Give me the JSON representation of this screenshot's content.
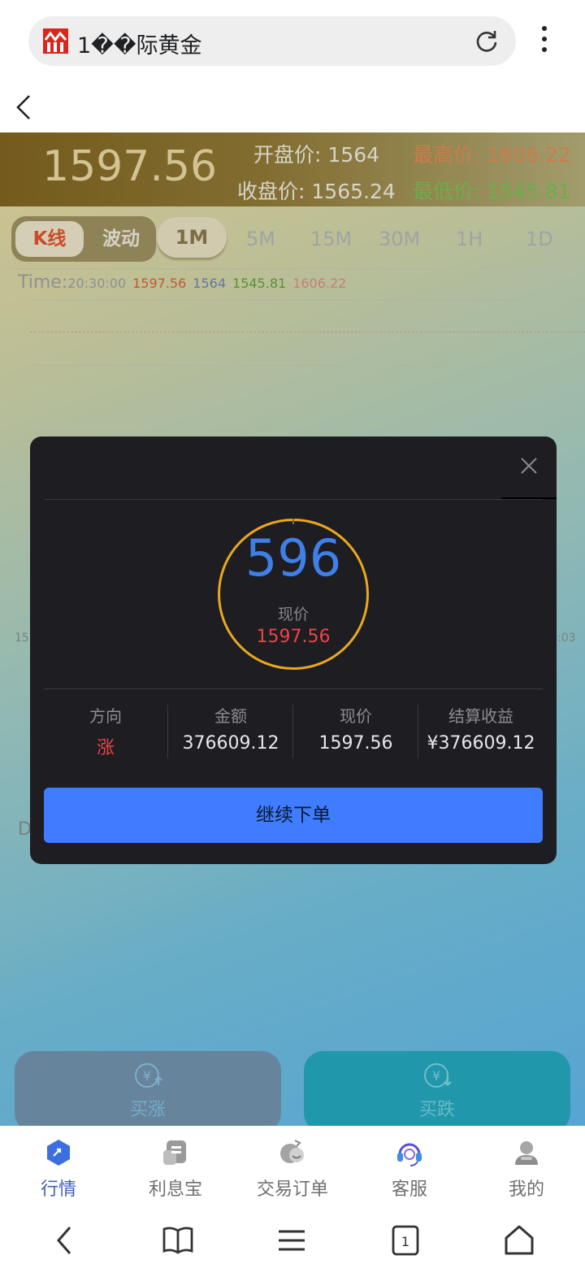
{
  "browser": {
    "url_text": "1��际黄金",
    "reload_icon": "reload-icon",
    "menu_icon": "more-vert-icon"
  },
  "header": {
    "back_icon": "chevron-left-icon"
  },
  "ticker": {
    "current_price": "1597.56",
    "open_label": "开盘价:",
    "open_value": "1564",
    "high_label": "最高价:",
    "high_value": "1606.22",
    "close_label": "收盘价:",
    "close_value": "1565.24",
    "low_label": "最低价:",
    "low_value": "1545.81"
  },
  "chart_mode": {
    "kline": "K线",
    "wave": "波动"
  },
  "timeframes": [
    "1M",
    "5M",
    "15M",
    "30M",
    "1H",
    "1D"
  ],
  "active_timeframe": "1M",
  "time_row": {
    "label": "Time:",
    "time": "20:30:00",
    "close": "1597.56",
    "open": "1564",
    "low": "1545.81",
    "high": "1606.22"
  },
  "axis": {
    "left_fragment": "15",
    "right_fragment": ":03",
    "d_fragment": "D"
  },
  "modal": {
    "countdown": "596",
    "price_label": "现价",
    "price_value": "1597.56",
    "stats": [
      {
        "label": "方向",
        "value": "涨"
      },
      {
        "label": "金额",
        "value": "376609.12"
      },
      {
        "label": "现价",
        "value": "1597.56"
      },
      {
        "label": "结算收益",
        "value": "¥376609.12"
      }
    ],
    "continue_label": "继续下单",
    "close_icon": "close-icon"
  },
  "actions": {
    "buy_up": "买涨",
    "buy_down": "买跌"
  },
  "tabs": [
    {
      "label": "行情",
      "icon": "market-icon",
      "active": true
    },
    {
      "label": "利息宝",
      "icon": "wallet-icon",
      "active": false
    },
    {
      "label": "交易订单",
      "icon": "orders-icon",
      "active": false
    },
    {
      "label": "客服",
      "icon": "headset-icon",
      "active": false
    },
    {
      "label": "我的",
      "icon": "profile-icon",
      "active": false
    }
  ],
  "colors": {
    "accent_blue": "#3f7cff",
    "rise_red": "#e8464a",
    "ring_gold": "#e8a820",
    "high_orange": "#e6884a",
    "low_green": "#74c44a"
  }
}
